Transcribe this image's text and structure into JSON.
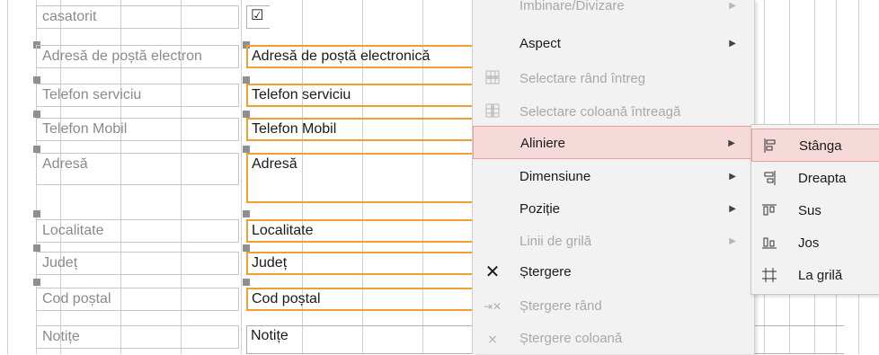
{
  "form": {
    "rows": [
      {
        "label": "casatorit",
        "value": "☑"
      },
      {
        "label": "Adresă de poștă electron",
        "value": "Adresă de poștă electronică"
      },
      {
        "label": "Telefon serviciu",
        "value": "Telefon serviciu"
      },
      {
        "label": "Telefon Mobil",
        "value": "Telefon Mobil"
      },
      {
        "label": "Adresă",
        "value": "Adresă"
      },
      {
        "label": "Localitate",
        "value": "Localitate"
      },
      {
        "label": "Județ",
        "value": "Județ"
      },
      {
        "label": "Cod poștal",
        "value": "Cod poștal"
      },
      {
        "label": "Notițe",
        "value": "Notițe"
      }
    ]
  },
  "context_menu": {
    "items": [
      {
        "label": "Îmbinare/Divizare",
        "disabled": true,
        "submenu": true
      },
      {
        "label": "Aspect",
        "disabled": false,
        "submenu": true
      },
      {
        "label": "Selectare rând întreg",
        "disabled": true,
        "icon": "select-row-icon"
      },
      {
        "label": "Selectare coloană întreagă",
        "disabled": true,
        "icon": "select-column-icon"
      },
      {
        "label": "Aliniere",
        "disabled": false,
        "submenu": true,
        "highlighted": true
      },
      {
        "label": "Dimensiune",
        "disabled": false,
        "submenu": true
      },
      {
        "label": "Poziție",
        "disabled": false,
        "submenu": true
      },
      {
        "label": "Linii de grilă",
        "disabled": true,
        "submenu": true
      },
      {
        "label": "Ștergere",
        "disabled": false,
        "icon": "delete-x-icon"
      },
      {
        "label": "Ștergere rând",
        "disabled": true,
        "icon": "delete-row-icon"
      },
      {
        "label": "Ștergere coloană",
        "disabled": true,
        "icon": "delete-column-icon"
      }
    ]
  },
  "align_submenu": {
    "items": [
      {
        "label": "Stânga",
        "icon": "align-left-icon",
        "highlighted": true
      },
      {
        "label": "Dreapta",
        "icon": "align-right-icon"
      },
      {
        "label": "Sus",
        "icon": "align-top-icon"
      },
      {
        "label": "Jos",
        "icon": "align-bottom-icon"
      },
      {
        "label": "La grilă",
        "icon": "align-grid-icon"
      }
    ]
  },
  "colors": {
    "selection_border": "#f0a030",
    "highlight": "#f6dada",
    "menu_bg": "#f2f2f2"
  }
}
